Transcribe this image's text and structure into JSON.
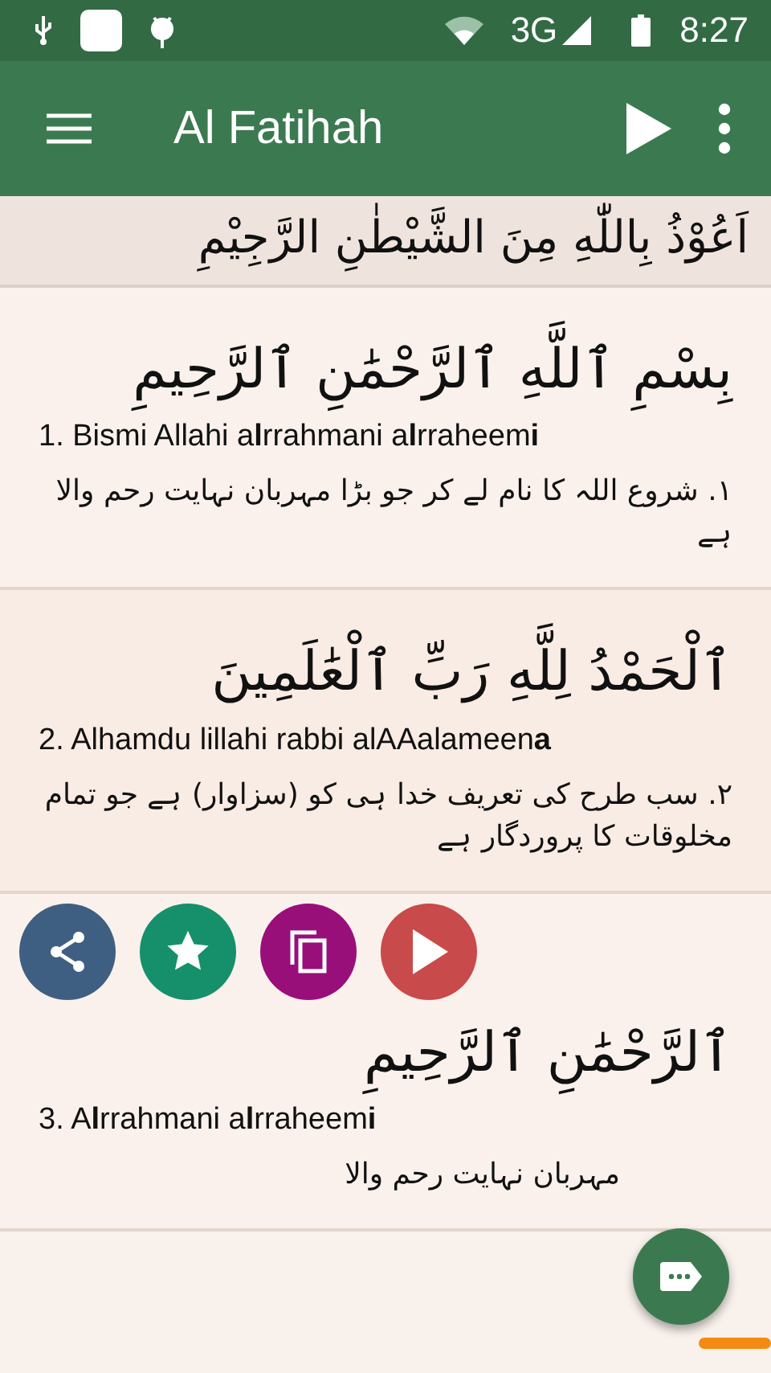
{
  "status_bar": {
    "network": "3G",
    "time": "8:27"
  },
  "toolbar": {
    "title": "Al Fatihah"
  },
  "header": {
    "arabic": "اَعُوْذُ بِاللّٰهِ مِنَ الشَّيْطٰنِ الرَّجِيْمِ"
  },
  "verses": [
    {
      "arabic": "بِسْمِ ٱللَّهِ ٱلرَّحْمَٰنِ ٱلرَّحِيمِ",
      "transliteration": "1. Bismi Allahi a**l**rrahmani a**l**rraheem**i**",
      "translation": "۱. شروع اللہ کا نام لے کر جو بڑا مہربان نہایت رحم والا ہے"
    },
    {
      "arabic": "ٱلْحَمْدُ لِلَّهِ رَبِّ ٱلْعَٰلَمِينَ",
      "transliteration": "2. Alhamdu lillahi rabbi alAAalameen**a**",
      "translation": "۲. سب طرح کی تعریف خدا ہی کو (سزاوار) ہے جو تمام مخلوقات کا پروردگار ہے"
    },
    {
      "arabic": "ٱلرَّحْمَٰنِ ٱلرَّحِيمِ",
      "transliteration": "3. A**l**rrahmani a**l**rraheem**i**",
      "translation": "مہربان نہایت رحم والا"
    }
  ],
  "actions": [
    {
      "kind": "share",
      "color": "#3f5f82"
    },
    {
      "kind": "favorite",
      "color": "#16906a"
    },
    {
      "kind": "copy",
      "color": "#990f7a"
    },
    {
      "kind": "play",
      "color": "#c94a4a"
    }
  ]
}
